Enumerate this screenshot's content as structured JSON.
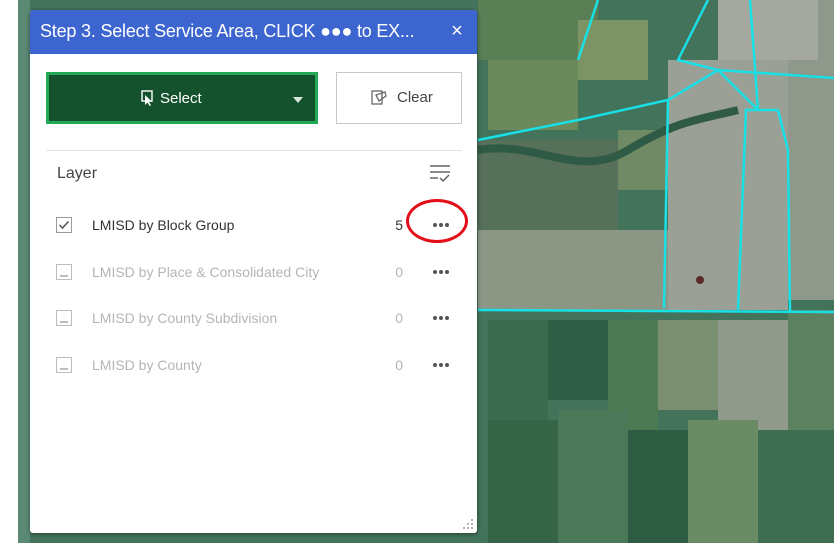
{
  "panel": {
    "title": "Step 3. Select Service Area, CLICK ●●● to EX...",
    "close_glyph": "×",
    "select_button": {
      "label": "Select",
      "icon": "select-icon"
    },
    "clear_button": {
      "label": "Clear",
      "icon": "clear-icon"
    },
    "layer_heading": "Layer",
    "filter_icon": "filter-icon",
    "layers": [
      {
        "name": "LMISD by Block Group",
        "count": "5",
        "checked": true,
        "enabled": true
      },
      {
        "name": "LMISD by Place & Consolidated City",
        "count": "0",
        "checked": false,
        "enabled": false
      },
      {
        "name": "LMISD by County Subdivision",
        "count": "0",
        "checked": false,
        "enabled": false
      },
      {
        "name": "LMISD by County",
        "count": "0",
        "checked": false,
        "enabled": false
      }
    ]
  },
  "colors": {
    "title_bar": "#3c65cf",
    "select_button_bg": "#14522e",
    "select_button_border": "#22a857",
    "boundary_lines": "#17e0e6",
    "highlight_ring": "#e3101a"
  }
}
